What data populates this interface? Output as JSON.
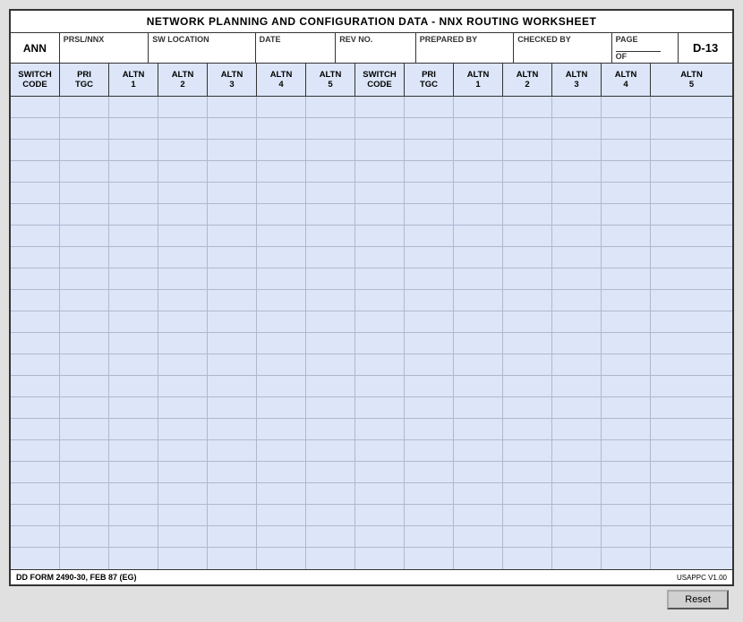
{
  "title": "NETWORK PLANNING AND CONFIGURATION DATA - NNX ROUTING WORKSHEET",
  "header": {
    "ann_label": "ANN",
    "prsl_label": "PRSL/NNX",
    "sw_location_label": "SW LOCATION",
    "date_label": "DATE",
    "rev_no_label": "REV NO.",
    "prepared_by_label": "PREPARED BY",
    "checked_by_label": "CHECKED BY",
    "page_label": "PAGE",
    "of_label": "OF",
    "form_id": "D-13"
  },
  "columns": [
    {
      "label": "SWITCH\nCODE",
      "key": "switch_code_1"
    },
    {
      "label": "PRI\nTGC",
      "key": "pri_tgc_1"
    },
    {
      "label": "ALTN\n1",
      "key": "altn1_1"
    },
    {
      "label": "ALTN\n2",
      "key": "altn2_1"
    },
    {
      "label": "ALTN\n3",
      "key": "altn3_1"
    },
    {
      "label": "ALTN\n4",
      "key": "altn4_1"
    },
    {
      "label": "ALTN\n5",
      "key": "altn5_1"
    },
    {
      "label": "SWITCH\nCODE",
      "key": "switch_code_2"
    },
    {
      "label": "PRI\nTGC",
      "key": "pri_tgc_2"
    },
    {
      "label": "ALTN\n1",
      "key": "altn1_2"
    },
    {
      "label": "ALTN\n2",
      "key": "altn2_2"
    },
    {
      "label": "ALTN\n3",
      "key": "altn3_2"
    },
    {
      "label": "ALTN\n4",
      "key": "altn4_2"
    },
    {
      "label": "ALTN\n5",
      "key": "altn5_2"
    }
  ],
  "num_rows": 22,
  "footer": {
    "form_name": "DD FORM 2490-30, FEB 87 (EG)",
    "version": "USAPPC V1.00"
  },
  "buttons": {
    "reset": "Reset"
  }
}
